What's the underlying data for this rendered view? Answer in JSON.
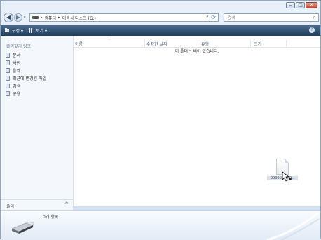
{
  "window": {
    "minimize_glyph": "–",
    "maximize_glyph": "□",
    "close_glyph": "✕"
  },
  "nav": {
    "back_glyph": "◀",
    "forward_glyph": "▶",
    "dropdown_glyph": "▾"
  },
  "address": {
    "breadcrumbs": [
      "컴퓨터",
      "이동식 디스크 (G:)"
    ],
    "separator": "▸",
    "dropdown_glyph": "▾",
    "refresh_glyph": "⟳"
  },
  "search": {
    "placeholder": "검색",
    "icon_glyph": "⌕"
  },
  "toolbar": {
    "organize_label": "구성 ▾",
    "views_label": "보기 ▾",
    "help_glyph": "?"
  },
  "sidebar": {
    "favorites_title": "즐겨찾기 링크",
    "items": [
      {
        "label": "문서",
        "icon": "document-icon"
      },
      {
        "label": "사진",
        "icon": "pictures-icon"
      },
      {
        "label": "음악",
        "icon": "music-icon"
      },
      {
        "label": "최근에 변경된 파일",
        "icon": "recent-files-icon"
      },
      {
        "label": "검색",
        "icon": "search-folder-icon"
      },
      {
        "label": "공용",
        "icon": "public-icon"
      }
    ],
    "folders_label": "폴더",
    "folders_chevron": "^"
  },
  "file_list": {
    "columns": [
      "이름",
      "수정한 날짜",
      "유형",
      "크기"
    ],
    "sort_glyph": "^",
    "empty_message": "이 폴더는 비어 있습니다."
  },
  "drag": {
    "file_label": "99990465.P..."
  },
  "details": {
    "item_count": "0개 항목"
  },
  "colors": {
    "toolbar": "#2a4a6c",
    "frame": "#cfdff0",
    "pane": "#f4f7fb"
  }
}
